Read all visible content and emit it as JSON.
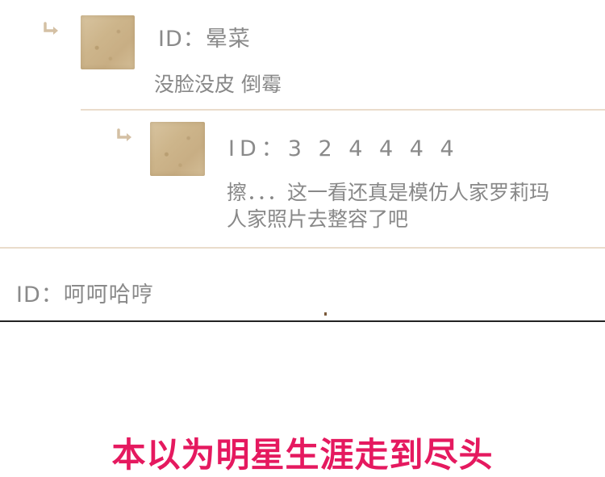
{
  "comments": [
    {
      "id_label": "ID：晕菜",
      "text": "没脸没皮   倒霉"
    },
    {
      "id_label": "ID：3 2 4 4 4 4",
      "text_line1": "擦．．．这一看还真是模仿人家罗莉玛",
      "text_line2": "人家照片去整容了吧"
    },
    {
      "id_label": "ID：呵呵哈哼"
    }
  ],
  "caption": "本以为明星生涯走到尽头",
  "colors": {
    "caption": "#e5195f",
    "divider": "#eadccb",
    "text": "#888888"
  }
}
